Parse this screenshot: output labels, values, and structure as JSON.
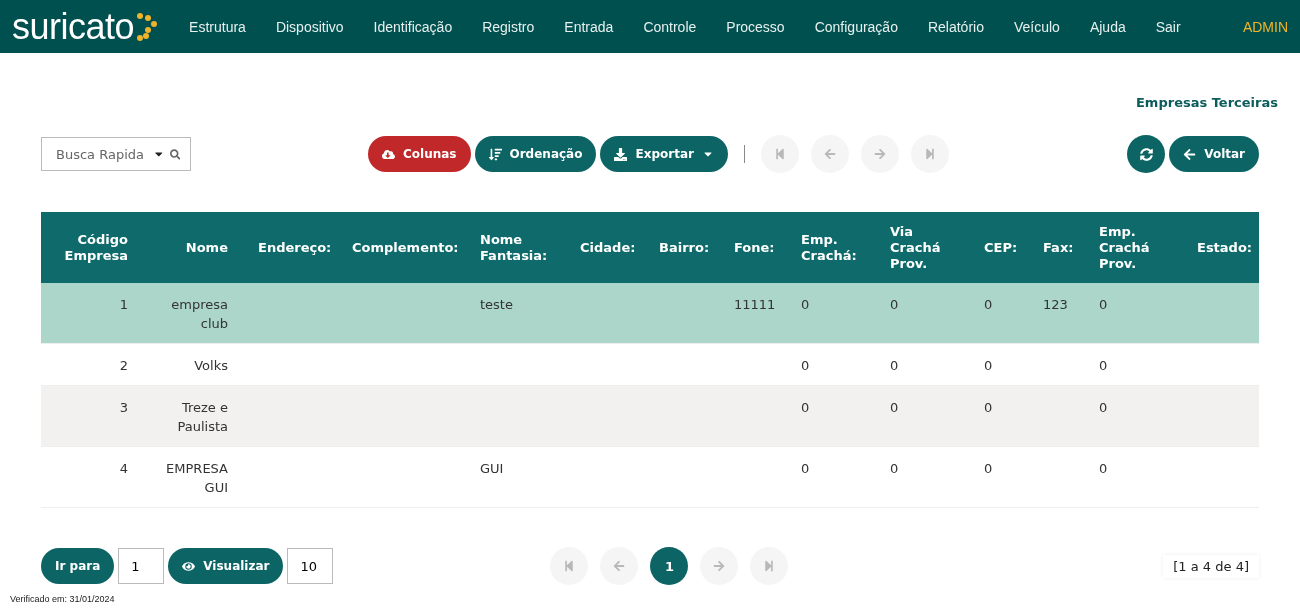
{
  "brand": "suricato",
  "nav": [
    "Estrutura",
    "Dispositivo",
    "Identificação",
    "Registro",
    "Entrada",
    "Controle",
    "Processo",
    "Configuração",
    "Relatório",
    "Veículo",
    "Ajuda",
    "Sair"
  ],
  "user": "ADMIN",
  "page_title": "Empresas Terceiras",
  "search": {
    "placeholder": "Busca Rapida"
  },
  "toolbar": [
    {
      "kind": "danger",
      "label": "Colunas"
    },
    {
      "kind": "primary",
      "label": "Ordenação"
    },
    {
      "kind": "dropdown",
      "label": "Exportar"
    }
  ],
  "top_pager": [
    {
      "kind": "first",
      "disabled": true
    },
    {
      "kind": "prev",
      "disabled": true
    },
    {
      "kind": "next",
      "disabled": true
    },
    {
      "kind": "last",
      "disabled": true
    }
  ],
  "actions": [
    {
      "kind": "refresh"
    },
    {
      "kind": "back",
      "label": "Voltar"
    }
  ],
  "table": {
    "columns": [
      "Código Empresa",
      "Nome",
      "Endereço:",
      "Complemento:",
      "Nome Fantasia:",
      "Cidade:",
      "Bairro:",
      "Fone:",
      "Emp. Crachá:",
      "Via Crachá Prov.",
      "CEP:",
      "Fax:",
      "Emp. Crachá Prov.",
      "Estado:"
    ],
    "rows": [
      {
        "selected": true,
        "cells": [
          "1",
          "empresa club",
          "",
          "",
          "teste",
          "",
          "",
          "11111",
          "0",
          "0",
          "0",
          "123",
          "0",
          ""
        ]
      },
      {
        "selected": false,
        "cells": [
          "2",
          "Volks",
          "",
          "",
          "",
          "",
          "",
          "",
          "0",
          "0",
          "0",
          "",
          "0",
          ""
        ]
      },
      {
        "selected": false,
        "cells": [
          "3",
          "Treze e Paulista",
          "",
          "",
          "",
          "",
          "",
          "",
          "0",
          "0",
          "0",
          "",
          "0",
          ""
        ]
      },
      {
        "selected": false,
        "cells": [
          "4",
          "EMPRESA GUI",
          "",
          "",
          "GUI",
          "",
          "",
          "",
          "0",
          "0",
          "0",
          "",
          "0",
          ""
        ]
      }
    ]
  },
  "footer": {
    "goto_label": "Ir para",
    "goto_value": "1",
    "view_label": "Visualizar",
    "view_value": "10",
    "pager": [
      {
        "kind": "first",
        "disabled": true
      },
      {
        "kind": "prev",
        "disabled": true
      },
      {
        "kind": "page",
        "label": "1",
        "selected": true
      },
      {
        "kind": "next",
        "disabled": true
      },
      {
        "kind": "last",
        "disabled": true
      }
    ],
    "range": "[1 a 4 de 4]"
  },
  "verified": "Verificado em: 31/01/2024"
}
